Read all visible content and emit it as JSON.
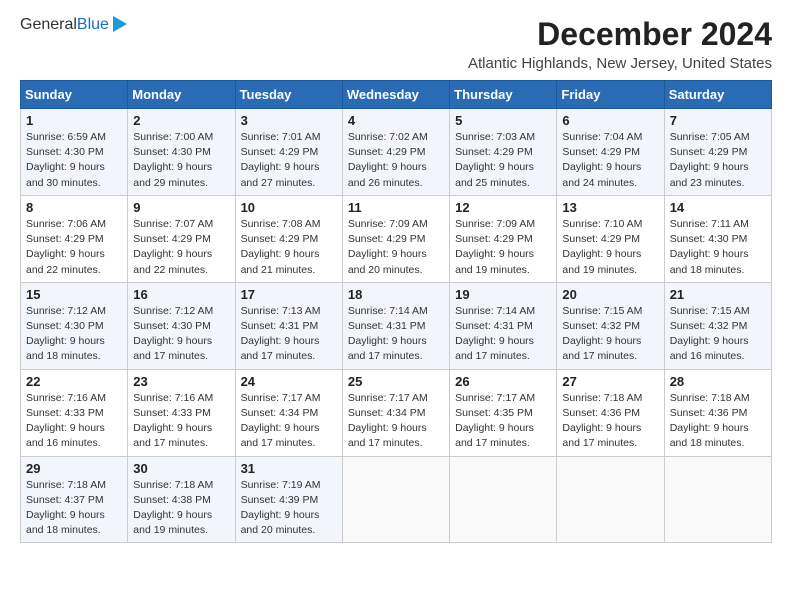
{
  "header": {
    "logo_general": "General",
    "logo_blue": "Blue",
    "title": "December 2024",
    "subtitle": "Atlantic Highlands, New Jersey, United States"
  },
  "days_of_week": [
    "Sunday",
    "Monday",
    "Tuesday",
    "Wednesday",
    "Thursday",
    "Friday",
    "Saturday"
  ],
  "weeks": [
    [
      {
        "day": "1",
        "sunrise": "Sunrise: 6:59 AM",
        "sunset": "Sunset: 4:30 PM",
        "daylight": "Daylight: 9 hours and 30 minutes."
      },
      {
        "day": "2",
        "sunrise": "Sunrise: 7:00 AM",
        "sunset": "Sunset: 4:30 PM",
        "daylight": "Daylight: 9 hours and 29 minutes."
      },
      {
        "day": "3",
        "sunrise": "Sunrise: 7:01 AM",
        "sunset": "Sunset: 4:29 PM",
        "daylight": "Daylight: 9 hours and 27 minutes."
      },
      {
        "day": "4",
        "sunrise": "Sunrise: 7:02 AM",
        "sunset": "Sunset: 4:29 PM",
        "daylight": "Daylight: 9 hours and 26 minutes."
      },
      {
        "day": "5",
        "sunrise": "Sunrise: 7:03 AM",
        "sunset": "Sunset: 4:29 PM",
        "daylight": "Daylight: 9 hours and 25 minutes."
      },
      {
        "day": "6",
        "sunrise": "Sunrise: 7:04 AM",
        "sunset": "Sunset: 4:29 PM",
        "daylight": "Daylight: 9 hours and 24 minutes."
      },
      {
        "day": "7",
        "sunrise": "Sunrise: 7:05 AM",
        "sunset": "Sunset: 4:29 PM",
        "daylight": "Daylight: 9 hours and 23 minutes."
      }
    ],
    [
      {
        "day": "8",
        "sunrise": "Sunrise: 7:06 AM",
        "sunset": "Sunset: 4:29 PM",
        "daylight": "Daylight: 9 hours and 22 minutes."
      },
      {
        "day": "9",
        "sunrise": "Sunrise: 7:07 AM",
        "sunset": "Sunset: 4:29 PM",
        "daylight": "Daylight: 9 hours and 22 minutes."
      },
      {
        "day": "10",
        "sunrise": "Sunrise: 7:08 AM",
        "sunset": "Sunset: 4:29 PM",
        "daylight": "Daylight: 9 hours and 21 minutes."
      },
      {
        "day": "11",
        "sunrise": "Sunrise: 7:09 AM",
        "sunset": "Sunset: 4:29 PM",
        "daylight": "Daylight: 9 hours and 20 minutes."
      },
      {
        "day": "12",
        "sunrise": "Sunrise: 7:09 AM",
        "sunset": "Sunset: 4:29 PM",
        "daylight": "Daylight: 9 hours and 19 minutes."
      },
      {
        "day": "13",
        "sunrise": "Sunrise: 7:10 AM",
        "sunset": "Sunset: 4:29 PM",
        "daylight": "Daylight: 9 hours and 19 minutes."
      },
      {
        "day": "14",
        "sunrise": "Sunrise: 7:11 AM",
        "sunset": "Sunset: 4:30 PM",
        "daylight": "Daylight: 9 hours and 18 minutes."
      }
    ],
    [
      {
        "day": "15",
        "sunrise": "Sunrise: 7:12 AM",
        "sunset": "Sunset: 4:30 PM",
        "daylight": "Daylight: 9 hours and 18 minutes."
      },
      {
        "day": "16",
        "sunrise": "Sunrise: 7:12 AM",
        "sunset": "Sunset: 4:30 PM",
        "daylight": "Daylight: 9 hours and 17 minutes."
      },
      {
        "day": "17",
        "sunrise": "Sunrise: 7:13 AM",
        "sunset": "Sunset: 4:31 PM",
        "daylight": "Daylight: 9 hours and 17 minutes."
      },
      {
        "day": "18",
        "sunrise": "Sunrise: 7:14 AM",
        "sunset": "Sunset: 4:31 PM",
        "daylight": "Daylight: 9 hours and 17 minutes."
      },
      {
        "day": "19",
        "sunrise": "Sunrise: 7:14 AM",
        "sunset": "Sunset: 4:31 PM",
        "daylight": "Daylight: 9 hours and 17 minutes."
      },
      {
        "day": "20",
        "sunrise": "Sunrise: 7:15 AM",
        "sunset": "Sunset: 4:32 PM",
        "daylight": "Daylight: 9 hours and 17 minutes."
      },
      {
        "day": "21",
        "sunrise": "Sunrise: 7:15 AM",
        "sunset": "Sunset: 4:32 PM",
        "daylight": "Daylight: 9 hours and 16 minutes."
      }
    ],
    [
      {
        "day": "22",
        "sunrise": "Sunrise: 7:16 AM",
        "sunset": "Sunset: 4:33 PM",
        "daylight": "Daylight: 9 hours and 16 minutes."
      },
      {
        "day": "23",
        "sunrise": "Sunrise: 7:16 AM",
        "sunset": "Sunset: 4:33 PM",
        "daylight": "Daylight: 9 hours and 17 minutes."
      },
      {
        "day": "24",
        "sunrise": "Sunrise: 7:17 AM",
        "sunset": "Sunset: 4:34 PM",
        "daylight": "Daylight: 9 hours and 17 minutes."
      },
      {
        "day": "25",
        "sunrise": "Sunrise: 7:17 AM",
        "sunset": "Sunset: 4:34 PM",
        "daylight": "Daylight: 9 hours and 17 minutes."
      },
      {
        "day": "26",
        "sunrise": "Sunrise: 7:17 AM",
        "sunset": "Sunset: 4:35 PM",
        "daylight": "Daylight: 9 hours and 17 minutes."
      },
      {
        "day": "27",
        "sunrise": "Sunrise: 7:18 AM",
        "sunset": "Sunset: 4:36 PM",
        "daylight": "Daylight: 9 hours and 17 minutes."
      },
      {
        "day": "28",
        "sunrise": "Sunrise: 7:18 AM",
        "sunset": "Sunset: 4:36 PM",
        "daylight": "Daylight: 9 hours and 18 minutes."
      }
    ],
    [
      {
        "day": "29",
        "sunrise": "Sunrise: 7:18 AM",
        "sunset": "Sunset: 4:37 PM",
        "daylight": "Daylight: 9 hours and 18 minutes."
      },
      {
        "day": "30",
        "sunrise": "Sunrise: 7:18 AM",
        "sunset": "Sunset: 4:38 PM",
        "daylight": "Daylight: 9 hours and 19 minutes."
      },
      {
        "day": "31",
        "sunrise": "Sunrise: 7:19 AM",
        "sunset": "Sunset: 4:39 PM",
        "daylight": "Daylight: 9 hours and 20 minutes."
      },
      null,
      null,
      null,
      null
    ]
  ]
}
